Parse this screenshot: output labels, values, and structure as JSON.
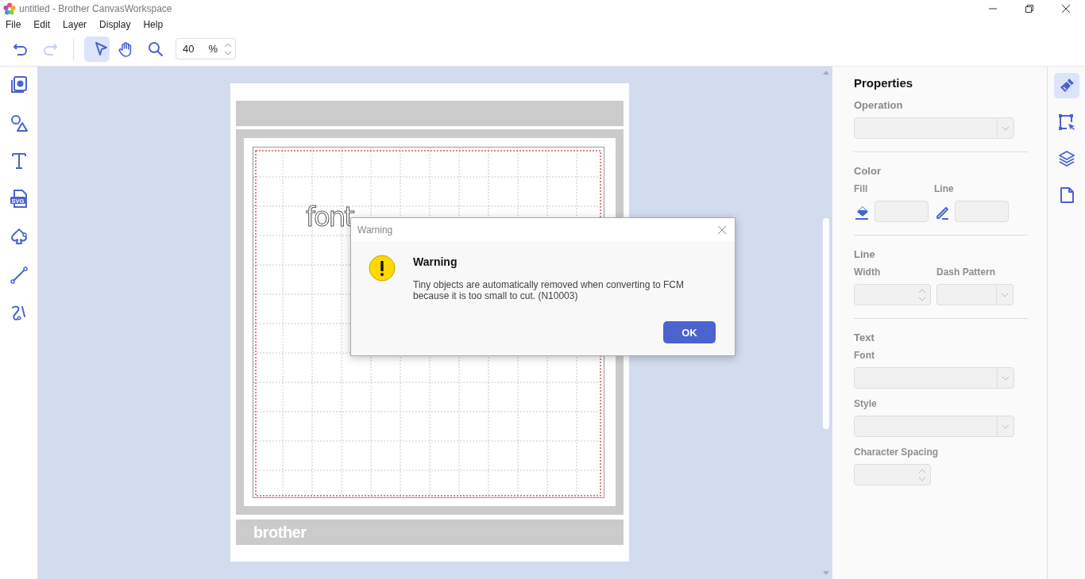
{
  "window": {
    "title": "untitled - Brother CanvasWorkspace"
  },
  "menu": [
    "File",
    "Edit",
    "Layer",
    "Display",
    "Help"
  ],
  "history": [
    {
      "kind": "undo",
      "disabled": false
    },
    {
      "kind": "redo",
      "disabled": true
    }
  ],
  "modes": [
    {
      "kind": "select",
      "selected": true
    },
    {
      "kind": "pan",
      "selected": false
    },
    {
      "kind": "zoom",
      "selected": false
    }
  ],
  "zoom": {
    "value": "40",
    "unit": "%"
  },
  "left_tools": [
    {
      "kind": "project"
    },
    {
      "kind": "shapes"
    },
    {
      "kind": "text"
    },
    {
      "kind": "svg",
      "label": "SVG"
    },
    {
      "kind": "outline"
    },
    {
      "kind": "line"
    },
    {
      "kind": "freehand"
    }
  ],
  "canvas": {
    "object_text": "font",
    "mat_logo": "brother"
  },
  "dialog": {
    "title": "Warning",
    "heading": "Warning",
    "message": "Tiny objects are automatically removed when converting to FCM\nbecause it is too small to cut. (N10003)",
    "ok": "OK"
  },
  "properties": {
    "title": "Properties",
    "sections": [
      {
        "heading": "Operation",
        "rows": [
          [
            {
              "kind": "wide-select",
              "disabled": true
            }
          ]
        ]
      },
      {
        "heading": "Color",
        "rows": [
          [
            {
              "kind": "fill-color",
              "label": "Fill",
              "disabled": true
            },
            {
              "kind": "line-color",
              "label": "Line",
              "disabled": true
            }
          ]
        ]
      },
      {
        "heading": "Line",
        "rows": [
          [
            {
              "kind": "spin",
              "label": "Width",
              "disabled": true
            },
            {
              "kind": "select",
              "label": "Dash Pattern",
              "disabled": true
            }
          ]
        ]
      },
      {
        "heading": "Text",
        "rows": [
          [
            {
              "kind": "wide-select",
              "label": "Font",
              "disabled": true
            }
          ],
          [
            {
              "kind": "wide-select",
              "label": "Style",
              "disabled": true
            }
          ],
          [
            {
              "kind": "spin",
              "label": "Character Spacing",
              "disabled": true
            }
          ]
        ]
      }
    ]
  },
  "right_tools": [
    {
      "kind": "brush",
      "selected": true
    },
    {
      "kind": "transform",
      "selected": false
    },
    {
      "kind": "layers",
      "selected": false
    },
    {
      "kind": "page",
      "selected": false
    }
  ]
}
